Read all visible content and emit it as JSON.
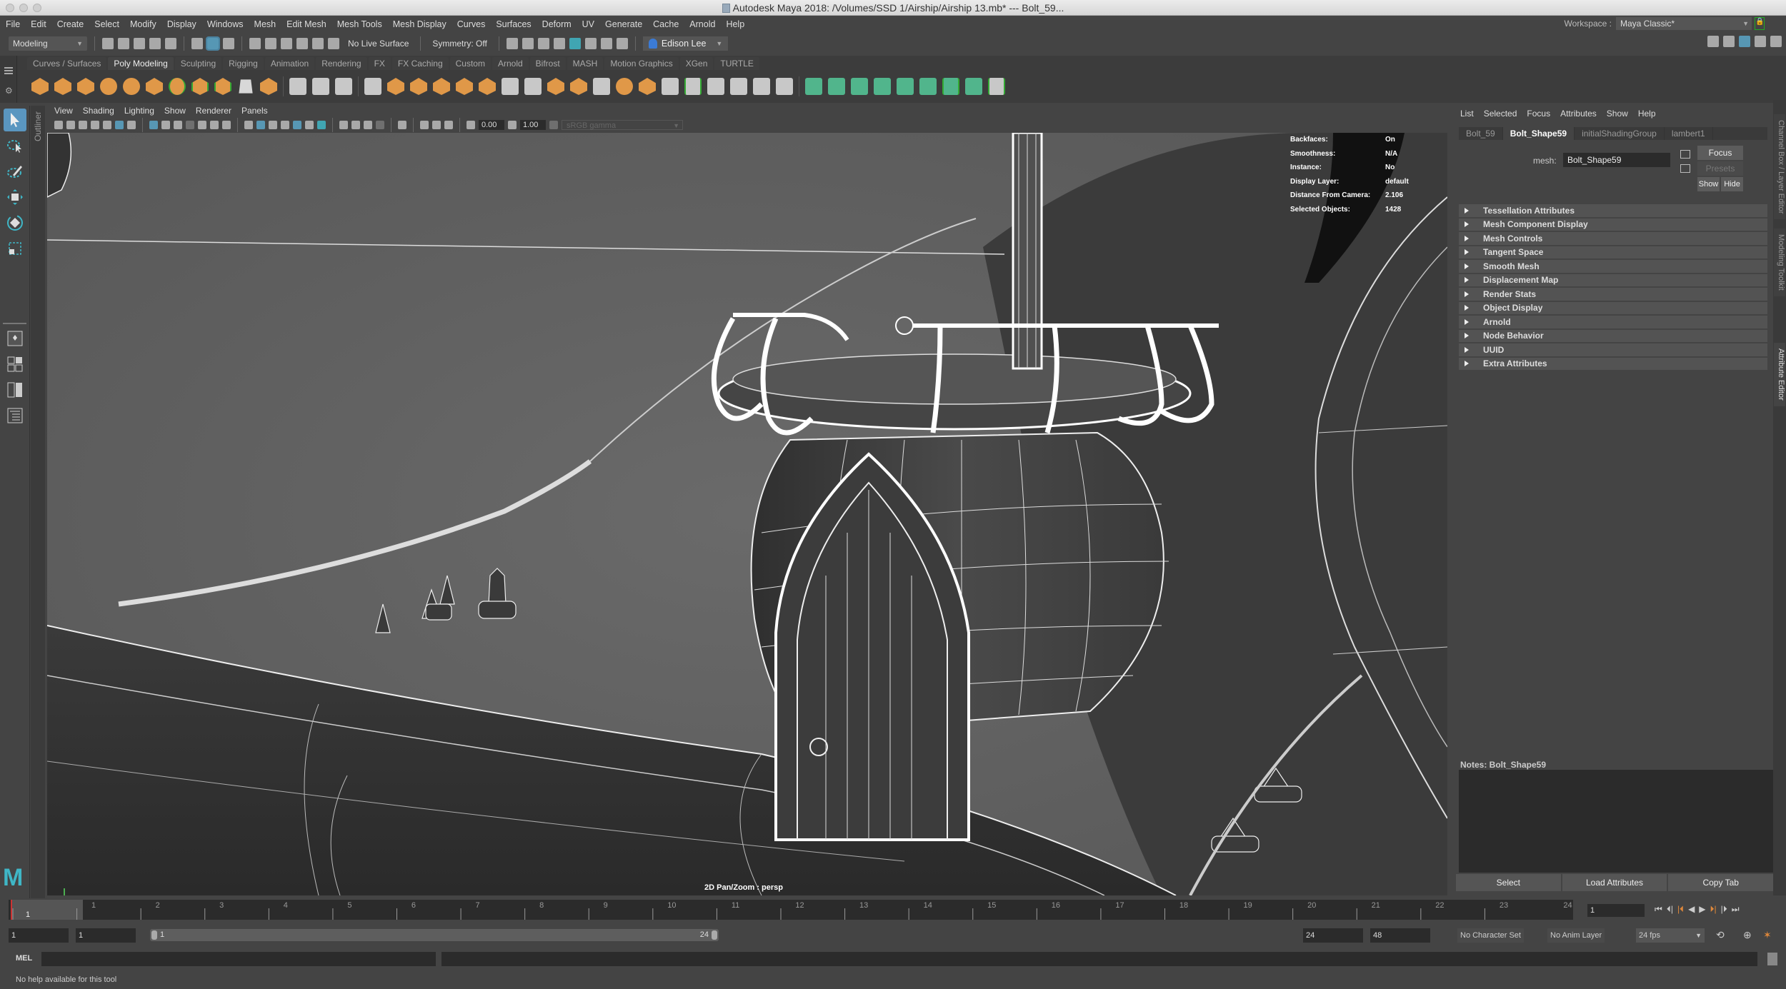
{
  "window": {
    "title": "Autodesk Maya 2018: /Volumes/SSD 1/Airship/Airship 13.mb*  ---  Bolt_59..."
  },
  "menubar": [
    "File",
    "Edit",
    "Create",
    "Select",
    "Modify",
    "Display",
    "Windows",
    "Mesh",
    "Edit Mesh",
    "Mesh Tools",
    "Mesh Display",
    "Curves",
    "Surfaces",
    "Deform",
    "UV",
    "Generate",
    "Cache",
    "Arnold",
    "Help"
  ],
  "workspace": {
    "label": "Workspace :",
    "value": "Maya Classic*"
  },
  "statusline": {
    "menuset": "Modeling",
    "live_surface": "No Live Surface",
    "symmetry": "Symmetry: Off",
    "user": "Edison Lee"
  },
  "shelf": {
    "tabs": [
      "Curves / Surfaces",
      "Poly Modeling",
      "Sculpting",
      "Rigging",
      "Animation",
      "Rendering",
      "FX",
      "FX Caching",
      "Custom",
      "Arnold",
      "Bifrost",
      "MASH",
      "Motion Graphics",
      "XGen",
      "TURTLE"
    ],
    "active_tab": "Poly Modeling",
    "icons": [
      "poly-sphere-icon",
      "poly-cube-icon",
      "poly-cylinder-icon",
      "poly-cone-icon",
      "poly-torus-icon",
      "poly-plane-icon",
      "poly-disc-icon",
      "platonic-solid-icon",
      "super-shape-icon",
      "type-icon",
      "svg-icon",
      "measure-icon",
      "mesh-info-icon",
      "coordinate-icon",
      "combine-icon",
      "separate-icon",
      "mirror-icon",
      "smooth-icon",
      "reduce-icon",
      "extract-icon",
      "booleans-icon",
      "bridge-icon",
      "extrude-icon",
      "bevel-icon",
      "fill-hole-icon",
      "append-icon",
      "merge-icon",
      "collapse-icon",
      "target-weld-icon",
      "connect-icon",
      "multi-cut-icon",
      "insert-edge-loop-icon",
      "offset-edge-loop-icon",
      "uv-editor-icon",
      "planar-uv-icon",
      "cylindrical-uv-icon",
      "spherical-uv-icon",
      "auto-uv-icon",
      "unfold-uv-icon",
      "uv-layout-icon",
      "cut-uv-icon",
      "sew-uv-icon"
    ]
  },
  "viewport": {
    "menu": [
      "View",
      "Shading",
      "Lighting",
      "Show",
      "Renderer",
      "Panels"
    ],
    "exposure": "0.00",
    "gamma": "1.00",
    "color_space": "sRGB gamma",
    "hud": [
      {
        "key": "Backfaces:",
        "value": "On"
      },
      {
        "key": "Smoothness:",
        "value": "N/A"
      },
      {
        "key": "Instance:",
        "value": "No"
      },
      {
        "key": "Display Layer:",
        "value": "default"
      },
      {
        "key": "Distance From Camera:",
        "value": "2.106"
      },
      {
        "key": "Selected Objects:",
        "value": "1428"
      }
    ],
    "camera_label": "2D Pan/Zoom : persp"
  },
  "outliner_tab": "Outliner",
  "toolbox": [
    "select-tool",
    "lasso-tool",
    "paint-select-tool",
    "move-tool",
    "rotate-tool",
    "scale-tool"
  ],
  "attribute_editor": {
    "menu": [
      "List",
      "Selected",
      "Focus",
      "Attributes",
      "Show",
      "Help"
    ],
    "tabs": [
      "Bolt_59",
      "Bolt_Shape59",
      "initialShadingGroup",
      "lambert1"
    ],
    "active_tab": "Bolt_Shape59",
    "mesh_label": "mesh:",
    "mesh_value": "Bolt_Shape59",
    "focus": "Focus",
    "presets": "Presets",
    "show": "Show",
    "hide": "Hide",
    "sections": [
      "Tessellation Attributes",
      "Mesh Component Display",
      "Mesh Controls",
      "Tangent Space",
      "Smooth Mesh",
      "Displacement Map",
      "Render Stats",
      "Object Display",
      "Arnold",
      "Node Behavior",
      "UUID",
      "Extra Attributes"
    ],
    "notes_label": "Notes:  Bolt_Shape59",
    "buttons": [
      "Select",
      "Load Attributes",
      "Copy Tab"
    ]
  },
  "side_tabs": [
    "Channel Box / Layer Editor",
    "Modeling Toolkit",
    "Attribute Editor"
  ],
  "timeslider": {
    "ticks": [
      "1",
      "2",
      "3",
      "4",
      "5",
      "6",
      "7",
      "8",
      "9",
      "10",
      "11",
      "12",
      "13",
      "14",
      "15",
      "16",
      "17",
      "18",
      "19",
      "20",
      "21",
      "22",
      "23",
      "24"
    ],
    "current_marker": "1",
    "current_frame": "1"
  },
  "rangeslider": {
    "start": "1",
    "playback_start": "1",
    "range_start": "1",
    "range_end": "24",
    "playback_end": "24",
    "end": "48",
    "character_set": "No Character Set",
    "anim_layer": "No Anim Layer",
    "fps": "24 fps"
  },
  "cmdline": {
    "label": "MEL"
  },
  "helpline": "No help available for this tool"
}
